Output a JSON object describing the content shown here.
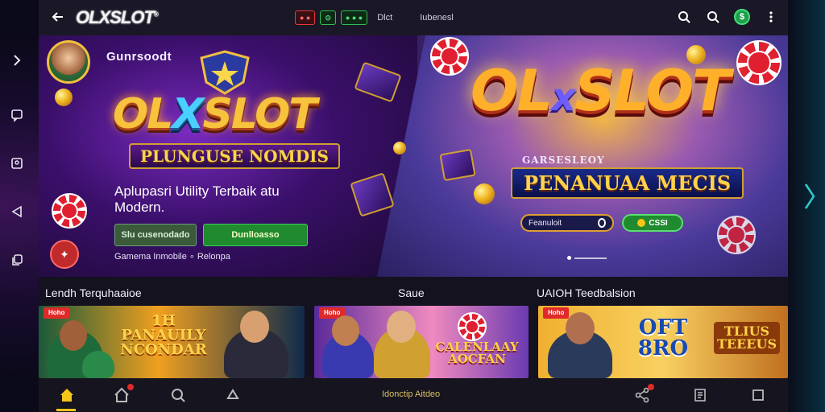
{
  "app": {
    "logo_main": "OLX",
    "logo_x": "S",
    "logo_rest": "LOT",
    "logo_superscript": "®"
  },
  "topbar": {
    "chip_red": "● ●",
    "chip_green1": "⊙",
    "chip_green2": "● ● ●",
    "nav_item_1": "Dlct",
    "nav_item_2": "Iubenesl"
  },
  "hero_left": {
    "brand": "Gunrsoodt",
    "logo_text_a": "OL",
    "logo_text_x": "X",
    "logo_text_b": "SLOT",
    "ribbon": "PLUNGUSE NOMDIS",
    "tagline": "Aplupasri Utility Terbaik  atu Modern.",
    "btn_outline": "Slu cusenodado",
    "btn_green": "Dunlloasso",
    "footnote": "Gamema Inmobile ∘ Relonpa"
  },
  "hero_right": {
    "logo_text_a": "OL",
    "logo_text_x": "x",
    "logo_text_b": "SLOT",
    "sub_ribbon": "GARSESLEOY",
    "ribbon": "PENANUAA MECIS",
    "search_label": "Feanuloit",
    "cta_label": "CSSI"
  },
  "sections": {
    "left_title": "Lendh Terquhaaioe",
    "mid_title": "Saue",
    "right_title": "UAIOH Teedbalsion"
  },
  "cards": [
    {
      "tag": "Hoho",
      "title": "1H PANAUILY NCONDAR"
    },
    {
      "tag": "Hoho",
      "title": "CALENLAAY AOCFAN"
    },
    {
      "tag": "Hoho",
      "title": "OFT 8RO",
      "side_title": "TLIUS TEEEUS"
    }
  ],
  "bottom_nav": {
    "center_text": "Idonctip Aitdeo"
  },
  "colors": {
    "accent_gold": "#f5c518",
    "accent_green": "#1f8a2e",
    "accent_red": "#e02a2a",
    "bg_dark": "#14121f"
  }
}
